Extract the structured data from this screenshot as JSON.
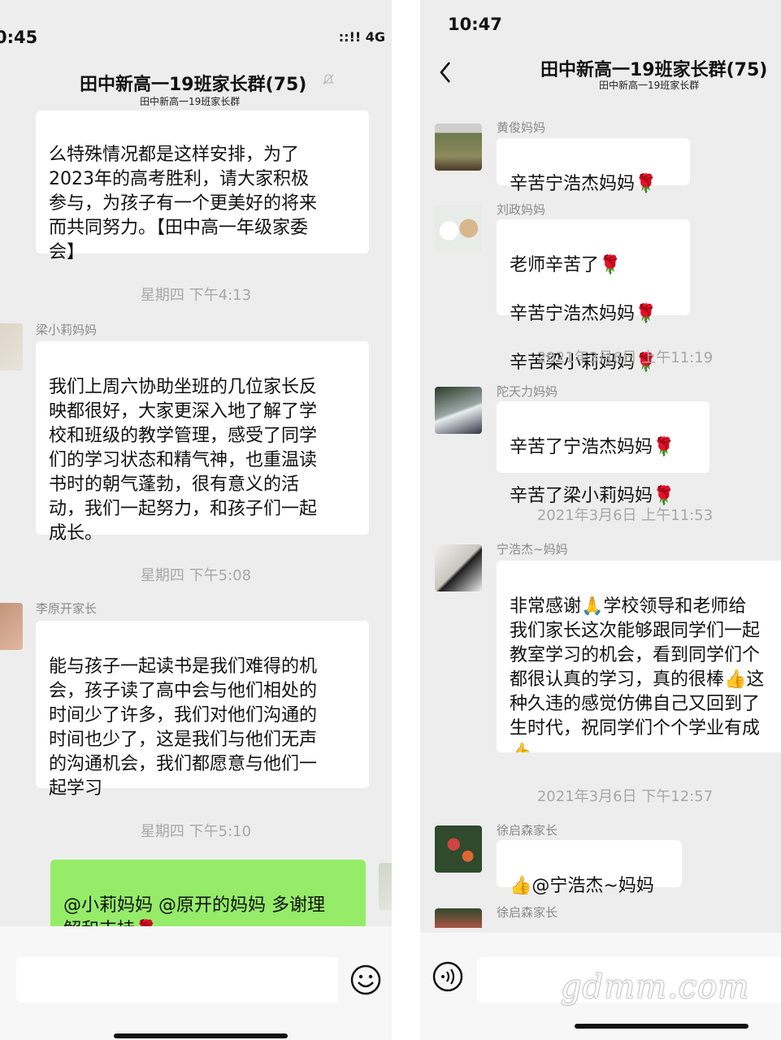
{
  "left": {
    "status_time": "0:45",
    "status_arrow": "◀",
    "status_signal": "::!! 4G",
    "title": "田中新高一19班家长群(75)",
    "subtitle": "田中新高一19班家长群",
    "messages": {
      "m0_text": "么特殊情况都是这样安排，为了\n2023年的高考胜利，请大家积极\n参与，为孩子有一个更美好的将来\n而共同努力。【田中高一年级家委\n会】",
      "ts1": "星期四 下午4:13",
      "m1_name": "梁小莉妈妈",
      "m1_text": "我们上周六协助坐班的几位家长反\n映都很好，大家更深入地了解了学\n校和班级的教学管理，感受了同学\n们的学习状态和精气神，也重温读\n书时的朝气蓬勃，很有意义的活\n动，我们一起努力，和孩子们一起\n成长。",
      "ts2": "星期四 下午5:08",
      "m2_name": "李原开家长",
      "m2_text": "能与孩子一起读书是我们难得的机\n会，孩子读了高中会与他们相处的\n时间少了许多，我们对他们沟通的\n时间也少了，这是我们与他们无声\n的沟通机会，我们都愿意与他们一\n起学习",
      "ts3": "星期四 下午5:10",
      "m3_text": "@小莉妈妈 @原开的妈妈 多谢理\n解和支持",
      "m3_emoji": "🌹"
    }
  },
  "right": {
    "status_time": "10:47",
    "title": "田中新高一19班家长群(75)",
    "subtitle": "田中新高一19班家长群",
    "messages": {
      "r1_name": "黄俊妈妈",
      "r1_text": "辛苦宁浩杰妈妈",
      "r2_name": "刘政妈妈",
      "r2_line1": "老师辛苦了",
      "r2_line2": "辛苦宁浩杰妈妈",
      "r2_line3": "辛苦梁小莉妈妈",
      "ts1": "2021年3月6日 上午11:19",
      "r3_name": "陀天力妈妈",
      "r3_line1": "辛苦了宁浩杰妈妈",
      "r3_line2": "辛苦了梁小莉妈妈",
      "ts2": "2021年3月6日 上午11:53",
      "r4_name": "宁浩杰~妈妈",
      "r4_text": "非常感谢🙏学校领导和老师给\n我们家长这次能够跟同学们一起\n教室学习的机会，看到同学们个\n都很认真的学习，真的很棒👍这\n种久违的感觉仿佛自己又回到了\n生时代，祝同学们个个学业有成\n👍",
      "ts3": "2021年3月6日 下午12:57",
      "r5_name": "徐启森家长",
      "r5_text": "👍@宁浩杰~妈妈",
      "r6_name": "徐启森家长"
    }
  },
  "rose": "🌹",
  "watermark": "gdmm.com",
  "colors": {
    "bg": "#ededed",
    "bubble": "#ffffff",
    "self_bubble": "#95ec69",
    "timestamp": "#a8a8a8"
  }
}
